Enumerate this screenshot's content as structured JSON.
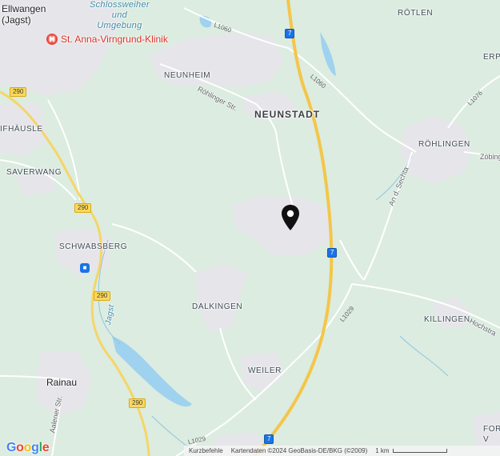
{
  "map": {
    "places": {
      "ellwangen": "Ellwangen\n(Jagst)",
      "schlossweiher": "Schlossweiher\nund\nUmgebung",
      "klinik": "St. Anna-Virngrund-Klinik",
      "neunheim": "NEUNHEIM",
      "neunstadt": "NEUNSTADT",
      "roetlen": "RÖTLEN",
      "erp": "ERP",
      "roehlingen": "RÖHLINGEN",
      "zoebingen": "Zöbing",
      "ifhaeusle": "IFHÄUSLE",
      "saverwang": "SAVERWANG",
      "schwabsberg": "SCHWABSBERG",
      "dalkingen": "DALKINGEN",
      "killingen": "KILLINGEN",
      "weiler": "WEILER",
      "rainau": "Rainau",
      "forv": "FOR\nV"
    },
    "streets": {
      "roehlinger": "Röhlinger Str.",
      "aalener": "Aalener Str.",
      "hochstr": "Hochstra",
      "sechta": "An d. Sechta",
      "jagst": "Jagst"
    },
    "shields": {
      "l1060a": "L1060",
      "l1060b": "L1060",
      "l1076": "L1076",
      "l1029a": "L1029",
      "l1029b": "L1029",
      "a7a": "7",
      "a7b": "7",
      "a7c": "7",
      "b290a": "290",
      "b290b": "290",
      "b290c": "290",
      "b290d": "290"
    },
    "colors": {
      "land": "#dcece0",
      "urban": "#e6e6ea",
      "water": "#9fd2ee",
      "motorway": "#f3c64a",
      "road": "#ffffff",
      "pin": "#111111",
      "poi": "#d93025"
    },
    "icons": [
      "location-pin-icon",
      "hospital-icon",
      "train-station-icon"
    ],
    "logo": "Google",
    "footer": {
      "shortcuts": "Kurzbefehle",
      "attribution": "Kartendaten ©2024 GeoBasis-DE/BKG (©2009)",
      "scale": "1 km"
    }
  }
}
